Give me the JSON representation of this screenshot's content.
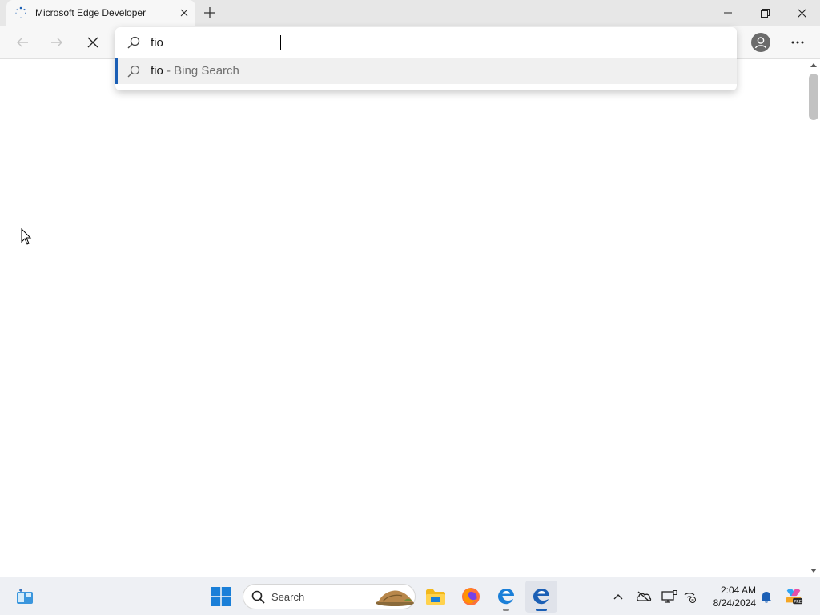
{
  "browser": {
    "tab": {
      "title": "Microsoft Edge Developer",
      "favicon": "loading-spinner-icon"
    },
    "new_tab_icon": "plus-icon",
    "window_controls": [
      "minimize-icon",
      "restore-icon",
      "close-icon"
    ]
  },
  "toolbar": {
    "buttons": [
      "back-arrow-icon",
      "forward-arrow-icon",
      "stop-loading-icon",
      "profile-icon",
      "more-menu-icon"
    ]
  },
  "omnibox": {
    "value": "fio",
    "suggestions": [
      {
        "query": "fio",
        "suffix": " - Bing Search",
        "icon": "search-icon"
      }
    ]
  },
  "taskbar": {
    "search_label": "Search",
    "pinned": [
      "windows-start-icon",
      "file-explorer-icon",
      "firefox-icon",
      "edge-icon",
      "edge-dev-icon"
    ],
    "tray_icons": [
      "chevron-up-icon",
      "onedrive-offline-icon",
      "display-icon",
      "network-icon",
      "notification-bell-icon",
      "copilot-pre-icon"
    ],
    "time": "2:04 AM",
    "date": "8/24/2024"
  },
  "colors": {
    "accent": "#1b5fb5",
    "titlebar": "#e7e7e7",
    "toolbar": "#f7f7f7",
    "taskbar": "#eef0f4"
  }
}
